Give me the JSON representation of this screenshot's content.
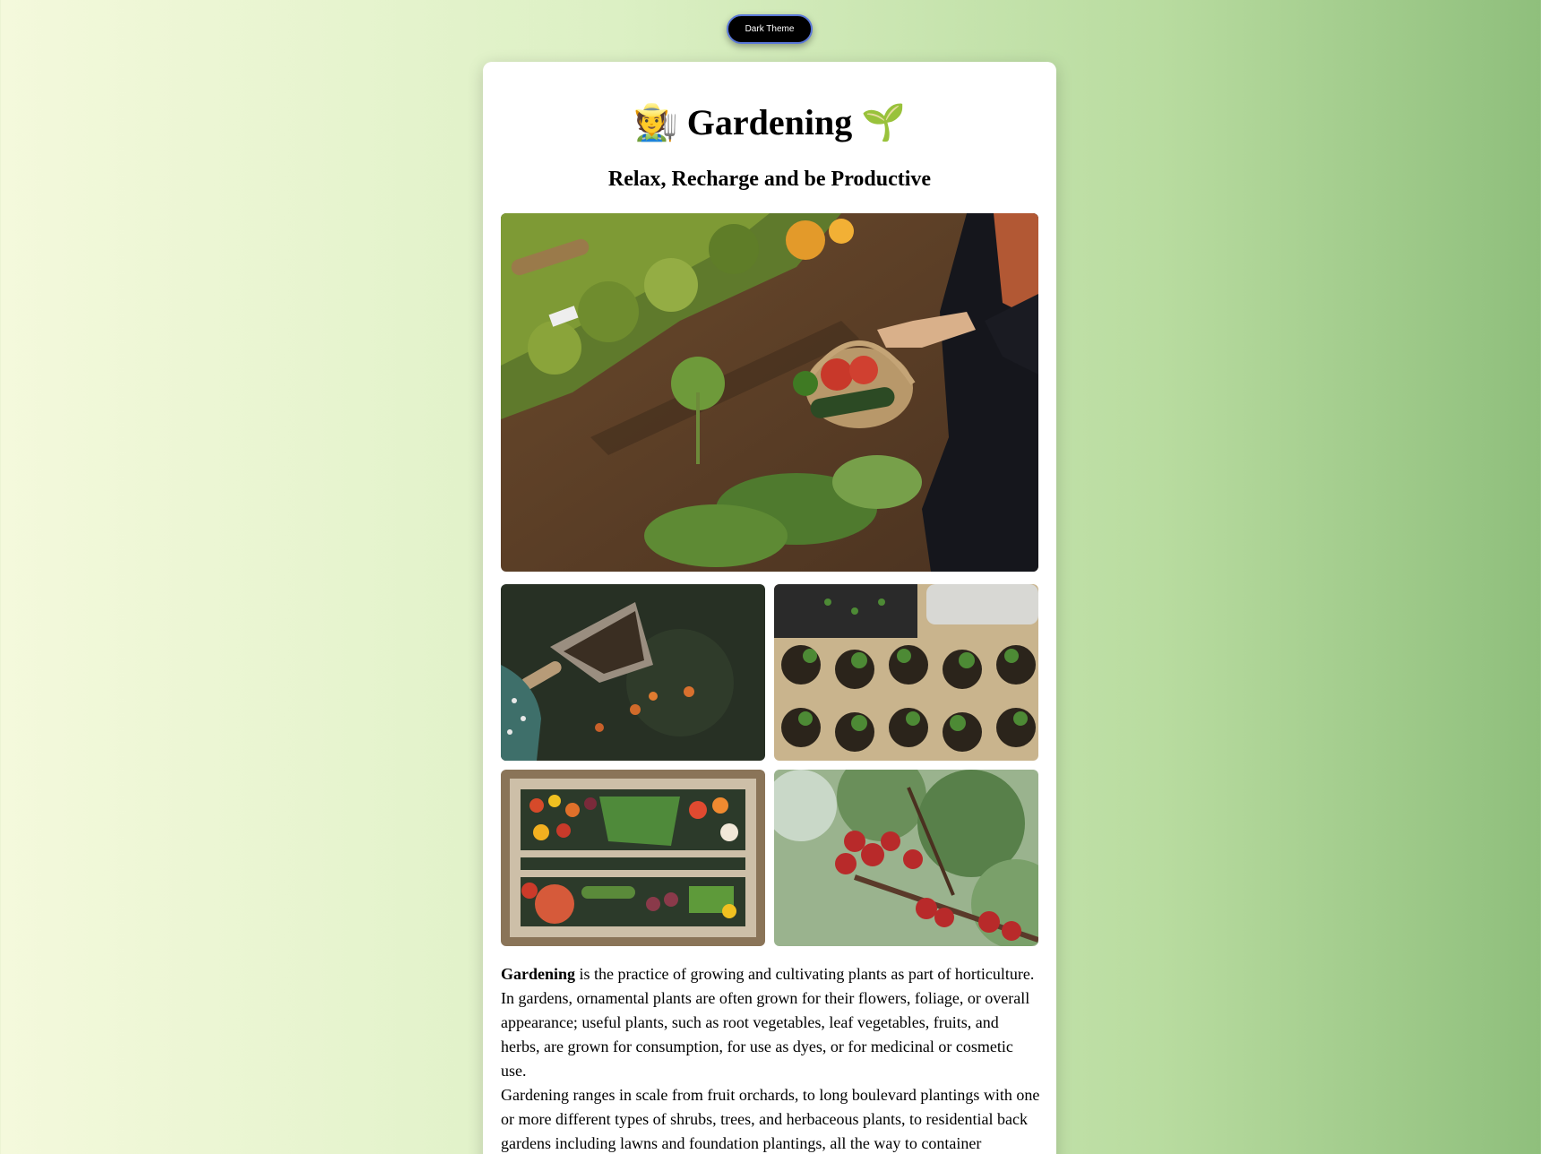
{
  "theme_button": {
    "label": "Dark Theme"
  },
  "header": {
    "title": "Gardening",
    "title_emoji_left": "farmer-icon",
    "title_emoji_right": "seedling-icon",
    "subtitle": "Relax, Recharge and be Productive"
  },
  "images": {
    "hero": "person harvesting vegetables into basket in garden",
    "gallery": [
      "trowel with soil",
      "seedlings in pots",
      "crate of vegetables",
      "apples on tree"
    ]
  },
  "content": {
    "p1_bold": "Gardening",
    "p1_rest": " is the practice of growing and cultivating plants as part of horticulture. In gardens, ornamental plants are often grown for their flowers, foliage, or overall appearance; useful plants, such as root vegetables, leaf vegetables, fruits, and herbs, are grown for consumption, for use as dyes, or for medicinal or cosmetic use.",
    "p2": "Gardening ranges in scale from fruit orchards, to long boulevard plantings with one or more different types of shrubs, trees, and herbaceous plants, to residential back gardens including lawns and foundation plantings, all the way to container"
  },
  "colors": {
    "button_bg": "#000000",
    "button_border": "#5a78d8",
    "card_bg": "#ffffff",
    "bg_left": "#f4f9dc",
    "bg_right": "#8fbf7c"
  }
}
